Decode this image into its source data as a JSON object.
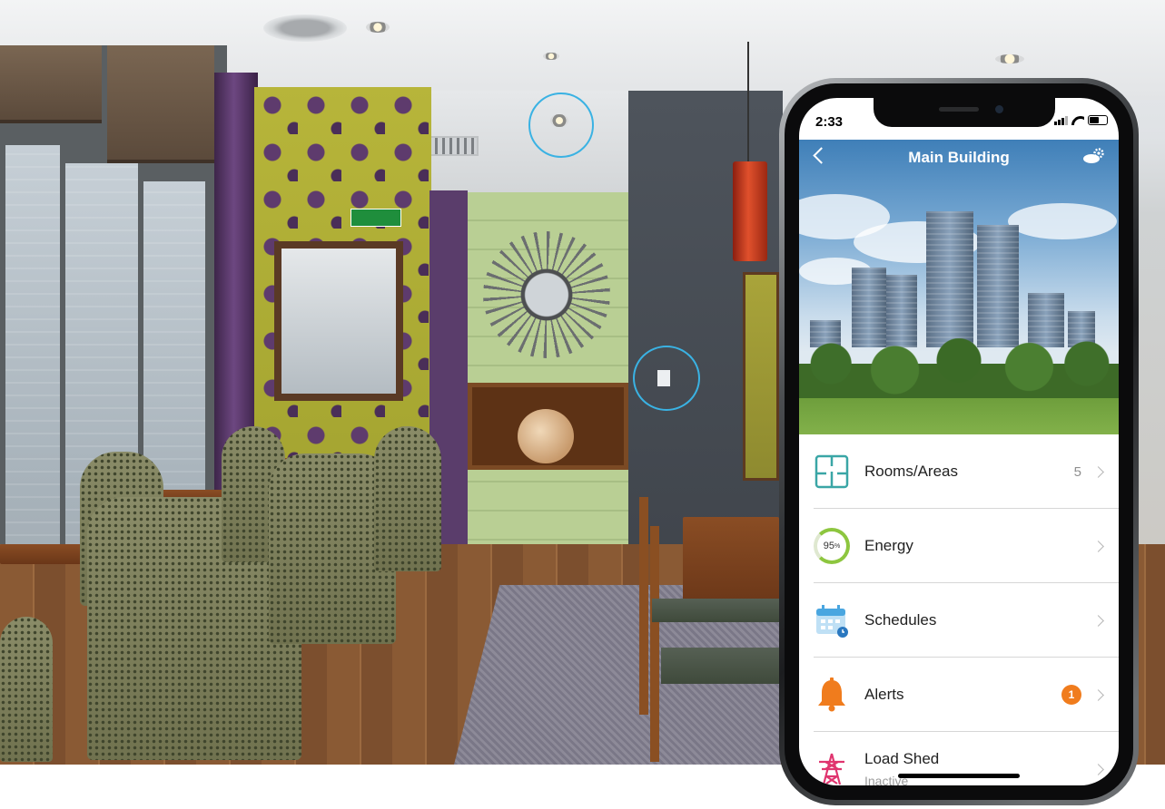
{
  "phone": {
    "status_time": "2:33",
    "title": "Main Building",
    "menu": [
      {
        "label": "Rooms/Areas",
        "count": "5"
      },
      {
        "label": "Energy",
        "gauge_value": "95",
        "gauge_unit": "%"
      },
      {
        "label": "Schedules"
      },
      {
        "label": "Alerts",
        "badge": "1"
      },
      {
        "label": "Load Shed",
        "sublabel": "Inactive"
      }
    ]
  },
  "photo": {
    "fire_sign": "Fire exit"
  },
  "colors": {
    "accent_ring": "#3ab2e3",
    "energy_green": "#8dc63f",
    "alert_orange": "#f07c1d",
    "rooms_teal": "#3aa6a6",
    "loadshed_pink": "#e0356f"
  },
  "icons": {
    "back": "chevron-left-icon",
    "settings": "cloud-gear-icon",
    "rooms": "floor-plan-icon",
    "energy": "gauge-ring-icon",
    "schedules": "calendar-clock-icon",
    "alerts": "bell-icon",
    "load_shed": "power-tower-icon"
  }
}
